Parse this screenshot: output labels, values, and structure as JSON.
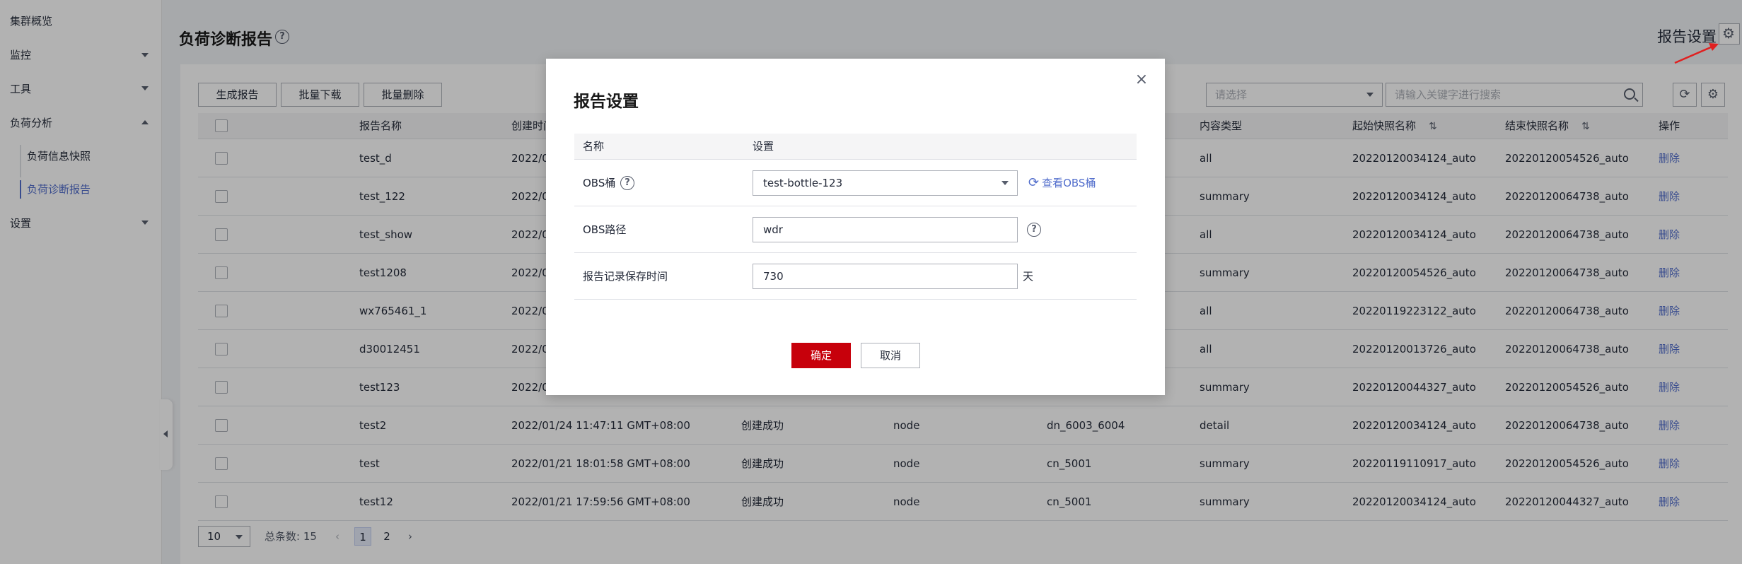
{
  "sidebar": {
    "items": [
      {
        "label": "集群概览"
      },
      {
        "label": "监控"
      },
      {
        "label": "工具"
      },
      {
        "label": "负荷分析"
      },
      {
        "label": "设置"
      }
    ],
    "sub_items": [
      {
        "label": "负荷信息快照"
      },
      {
        "label": "负荷诊断报告"
      }
    ]
  },
  "header": {
    "title": "负荷诊断报告",
    "help": "?",
    "report_settings_label": "报告设置",
    "gear_icon": "gear-icon"
  },
  "toolbar": {
    "generate_label": "生成报告",
    "batch_download_label": "批量下载",
    "batch_delete_label": "批量删除",
    "select_placeholder": "请选择",
    "search_placeholder": "请输入关键字进行搜索",
    "refresh_glyph": "⟳",
    "gear_glyph": "⚙"
  },
  "table": {
    "columns": {
      "name": "报告名称",
      "created": "创建时间",
      "content_type": "内容类型",
      "start_snapshot": "起始快照名称",
      "end_snapshot": "结束快照名称",
      "action": "操作"
    },
    "rows": [
      {
        "name": "test_d",
        "created": "2022/0",
        "status": "",
        "node_type": "",
        "node": "",
        "content": "all",
        "start": "20220120034124_auto",
        "end": "20220120054526_auto",
        "action": "删除"
      },
      {
        "name": "test_122",
        "created": "2022/0",
        "status": "",
        "node_type": "",
        "node": "",
        "content": "summary",
        "start": "20220120034124_auto",
        "end": "20220120064738_auto",
        "action": "删除"
      },
      {
        "name": "test_show",
        "created": "2022/0",
        "status": "",
        "node_type": "",
        "node": "",
        "content": "all",
        "start": "20220120034124_auto",
        "end": "20220120064738_auto",
        "action": "删除"
      },
      {
        "name": "test1208",
        "created": "2022/0",
        "status": "",
        "node_type": "",
        "node": "",
        "content": "summary",
        "start": "20220120054526_auto",
        "end": "20220120064738_auto",
        "action": "删除"
      },
      {
        "name": "wx765461_1",
        "created": "2022/0",
        "status": "",
        "node_type": "",
        "node": "",
        "content": "all",
        "start": "20220119223122_auto",
        "end": "20220120064738_auto",
        "action": "删除"
      },
      {
        "name": "d30012451",
        "created": "2022/0",
        "status": "",
        "node_type": "",
        "node": "",
        "content": "all",
        "start": "20220120013726_auto",
        "end": "20220120064738_auto",
        "action": "删除"
      },
      {
        "name": "test123",
        "created": "2022/0",
        "status": "",
        "node_type": "",
        "node": "",
        "content": "summary",
        "start": "20220120044327_auto",
        "end": "20220120054526_auto",
        "action": "删除"
      },
      {
        "name": "test2",
        "created": "2022/01/24 11:47:11 GMT+08:00",
        "status": "创建成功",
        "node_type": "node",
        "node": "dn_6003_6004",
        "content": "detail",
        "start": "20220120034124_auto",
        "end": "20220120064738_auto",
        "action": "删除"
      },
      {
        "name": "test",
        "created": "2022/01/21 18:01:58 GMT+08:00",
        "status": "创建成功",
        "node_type": "node",
        "node": "cn_5001",
        "content": "summary",
        "start": "20220119110917_auto",
        "end": "20220120054526_auto",
        "action": "删除"
      },
      {
        "name": "test12",
        "created": "2022/01/21 17:59:56 GMT+08:00",
        "status": "创建成功",
        "node_type": "node",
        "node": "cn_5001",
        "content": "summary",
        "start": "20220120034124_auto",
        "end": "20220120044327_auto",
        "action": "删除"
      }
    ]
  },
  "pagination": {
    "page_size": "10",
    "total": "总条数: 15",
    "prev": "‹",
    "pages": [
      "1",
      "2"
    ],
    "next": "›"
  },
  "dialog": {
    "title": "报告设置",
    "close": "×",
    "col_name": "名称",
    "col_setting": "设置",
    "obs_bucket_label": "OBS桶",
    "obs_bucket_value": "test-bottle-123",
    "view_obs_link": "查看OBS桶",
    "obs_path_label": "OBS路径",
    "obs_path_value": "wdr",
    "retention_label": "报告记录保存时间",
    "retention_value": "730",
    "retention_unit": "天",
    "ok_label": "确定",
    "cancel_label": "取消"
  },
  "colors": {
    "accent": "#526ecc",
    "primary_button": "#c7000b",
    "annotation_arrow": "#e02020"
  }
}
